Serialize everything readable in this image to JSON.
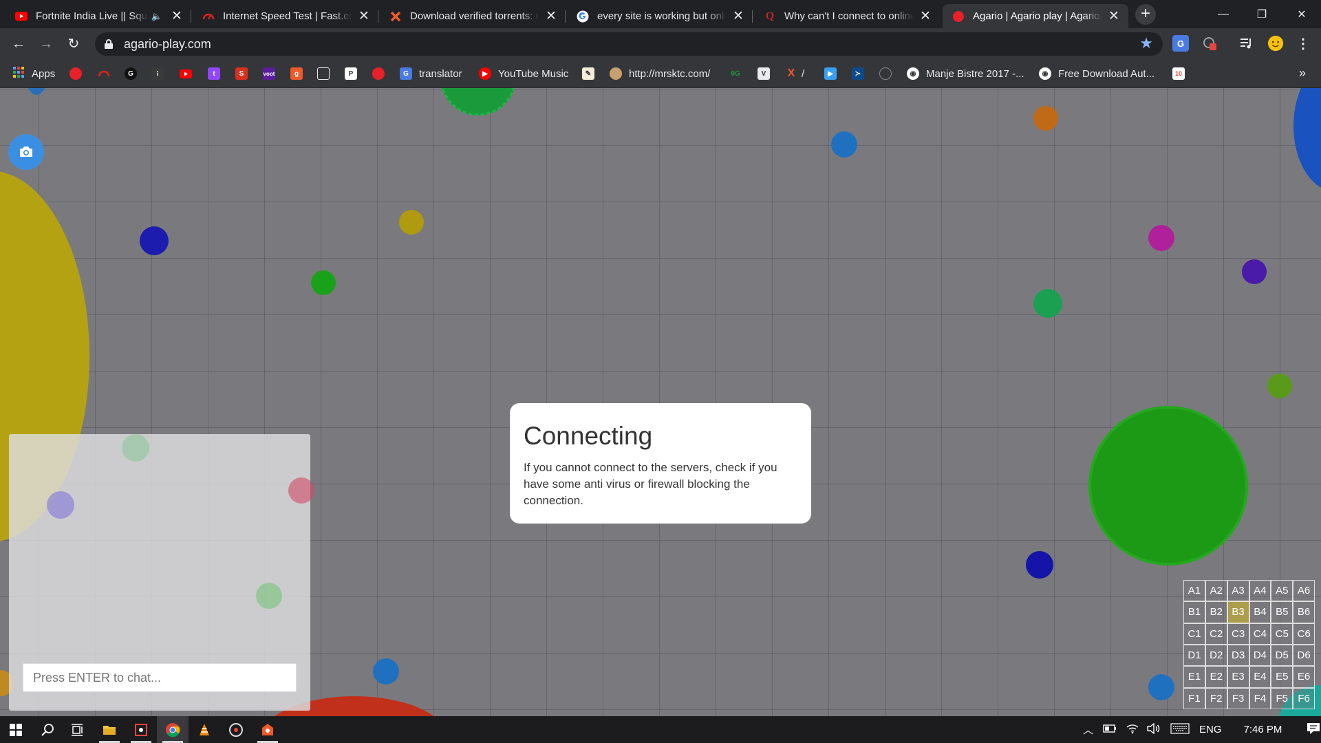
{
  "tabs": [
    {
      "title": "Fortnite India Live || Squad",
      "audio": "🔈",
      "close": "✕"
    },
    {
      "title": "Internet Speed Test | Fast.com",
      "close": "✕"
    },
    {
      "title": "Download verified torrents: m",
      "close": "✕"
    },
    {
      "title": "every site is working but onli",
      "close": "✕"
    },
    {
      "title": "Why can't I connect to online",
      "close": "✕"
    },
    {
      "title": "Agario | Agario play | Agario",
      "close": "✕"
    }
  ],
  "window": {
    "new_tab": "+",
    "minimize": "—",
    "restore": "❐",
    "close": "✕"
  },
  "toolbar": {
    "back": "←",
    "forward": "→",
    "reload": "↻",
    "url": "agario-play.com",
    "star": "★"
  },
  "bookmarks": {
    "apps": "Apps",
    "translator": "translator",
    "youtube_music": "YouTube Music",
    "mrsktc": "http://mrsktc.com/",
    "slash": "/",
    "manje": "Manje Bistre 2017 -...",
    "free_download": "Free Download Aut...",
    "more": "»"
  },
  "game": {
    "dialog_title": "Connecting",
    "dialog_body": "If you cannot connect to the servers, check if you have some anti virus or firewall blocking the connection.",
    "chat_placeholder": "Press ENTER to chat...",
    "minimap_rows": [
      "A",
      "B",
      "C",
      "D",
      "E",
      "F"
    ],
    "minimap_cols": [
      "1",
      "2",
      "3",
      "4",
      "5",
      "6"
    ],
    "minimap_highlight": "B3"
  },
  "taskbar": {
    "language": "ENG",
    "time": "7:46 PM"
  },
  "colors": {
    "grid_bg": "#7a7a7e",
    "accent_blue": "#3b8fe3",
    "tab_bg": "#202124",
    "toolbar_bg": "#35363a"
  }
}
